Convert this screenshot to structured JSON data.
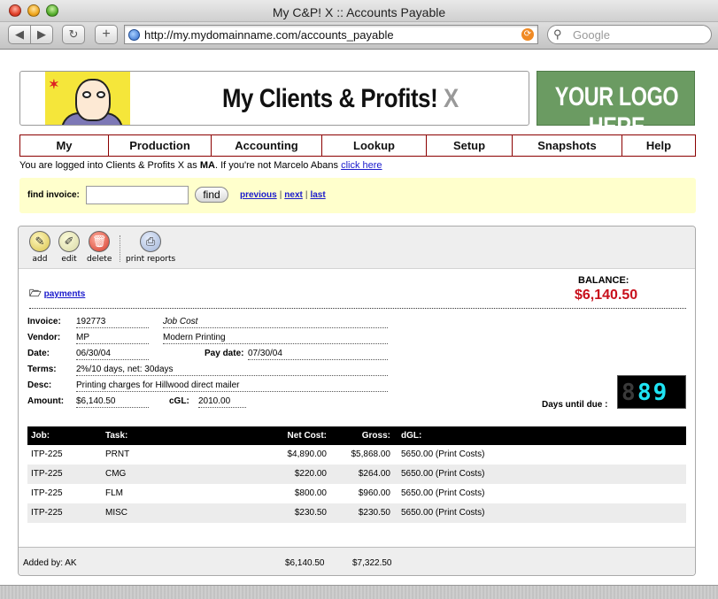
{
  "window": {
    "title": "My C&P! X :: Accounts Payable"
  },
  "browser": {
    "back_icon": "◀",
    "forward_icon": "▶",
    "reload_icon": "↻",
    "add_icon": "+",
    "url": "http://my.mydomainname.com/accounts_payable",
    "rss_icon": "⟳",
    "search_placeholder": "Google",
    "search_icon": "⚲"
  },
  "banner": {
    "title": "My Clients & Profits!",
    "title_suffix": "X",
    "logo_text": "YOUR LOGO HERE"
  },
  "menu": {
    "items": [
      "My",
      "Production",
      "Accounting",
      "Lookup",
      "Setup",
      "Snapshots",
      "Help"
    ]
  },
  "login": {
    "prefix": "You are logged into Clients & Profits X as",
    "user": "MA",
    "middle": ". If you're not Marcelo Abans",
    "link": "click here"
  },
  "find": {
    "label": "find invoice:",
    "value": "",
    "button": "find",
    "previous": "previous",
    "next": "next",
    "last": "last",
    "separator": "|"
  },
  "toolbar": {
    "add": {
      "label": "add",
      "icon": "pencil-icon",
      "glyph": "✎"
    },
    "edit": {
      "label": "edit",
      "icon": "edit-icon",
      "glyph": "✐"
    },
    "delete": {
      "label": "delete",
      "icon": "trash-icon",
      "glyph": "🗑"
    },
    "print": {
      "label": "print reports",
      "icon": "printer-icon",
      "glyph": "⎙"
    }
  },
  "record": {
    "payments_link": "payments",
    "folder_glyph": "🗁",
    "balance_label": "BALANCE:",
    "balance": "$6,140.50",
    "invoice_label": "Invoice:",
    "invoice": "192773",
    "invoice_type": "Job Cost",
    "vendor_label": "Vendor:",
    "vendor_code": "MP",
    "vendor_name": "Modern Printing",
    "date_label": "Date:",
    "date": "06/30/04",
    "paydate_label": "Pay date:",
    "paydate": "07/30/04",
    "terms_label": "Terms:",
    "terms": "2%/10 days, net: 30days",
    "desc_label": "Desc:",
    "desc": "Printing charges for Hillwood direct mailer",
    "amount_label": "Amount:",
    "amount": "$6,140.50",
    "cgl_label": "cGL:",
    "cgl": "2010.00",
    "days_label": "Days until due :",
    "days_off_digit": "8",
    "days": "89"
  },
  "table": {
    "headers": {
      "job": "Job:",
      "task": "Task:",
      "net": "Net Cost:",
      "gross": "Gross:",
      "gl": "dGL:"
    },
    "rows": [
      {
        "job": "ITP-225",
        "task": "PRNT",
        "net": "$4,890.00",
        "gross": "$5,868.00",
        "gl": "5650.00 (Print Costs)"
      },
      {
        "job": "ITP-225",
        "task": "CMG",
        "net": "$220.00",
        "gross": "$264.00",
        "gl": "5650.00 (Print Costs)"
      },
      {
        "job": "ITP-225",
        "task": "FLM",
        "net": "$800.00",
        "gross": "$960.00",
        "gl": "5650.00 (Print Costs)"
      },
      {
        "job": "ITP-225",
        "task": "MISC",
        "net": "$230.50",
        "gross": "$230.50",
        "gl": "5650.00 (Print Costs)"
      }
    ]
  },
  "footer": {
    "added_by": "Added by: AK",
    "net_total": "$6,140.50",
    "gross_total": "$7,322.50"
  },
  "colors": {
    "menu_border": "#8b0000",
    "balance": "#c8101c",
    "find_bg": "#ffffcc",
    "logo_bg": "#6b9b62",
    "digits": "#1fe4f4"
  }
}
